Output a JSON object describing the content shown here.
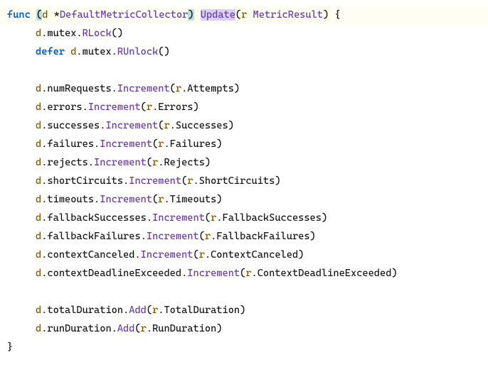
{
  "keywords": {
    "func": "func",
    "defer": "defer"
  },
  "sig": {
    "receiver_var": "d",
    "star": "*",
    "receiver_type": "DefaultMetricCollector",
    "func_name": "Update",
    "param_var": "r",
    "param_type": "MetricResult"
  },
  "lock": {
    "var": "d",
    "mutex": "mutex",
    "rlock": "RLock",
    "runlock": "RUnlock"
  },
  "lines": [
    {
      "obj": "d",
      "field": "numRequests",
      "method": "Increment",
      "arg_obj": "r",
      "arg_field": "Attempts"
    },
    {
      "obj": "d",
      "field": "errors",
      "method": "Increment",
      "arg_obj": "r",
      "arg_field": "Errors"
    },
    {
      "obj": "d",
      "field": "successes",
      "method": "Increment",
      "arg_obj": "r",
      "arg_field": "Successes"
    },
    {
      "obj": "d",
      "field": "failures",
      "method": "Increment",
      "arg_obj": "r",
      "arg_field": "Failures"
    },
    {
      "obj": "d",
      "field": "rejects",
      "method": "Increment",
      "arg_obj": "r",
      "arg_field": "Rejects"
    },
    {
      "obj": "d",
      "field": "shortCircuits",
      "method": "Increment",
      "arg_obj": "r",
      "arg_field": "ShortCircuits"
    },
    {
      "obj": "d",
      "field": "timeouts",
      "method": "Increment",
      "arg_obj": "r",
      "arg_field": "Timeouts"
    },
    {
      "obj": "d",
      "field": "fallbackSuccesses",
      "method": "Increment",
      "arg_obj": "r",
      "arg_field": "FallbackSuccesses"
    },
    {
      "obj": "d",
      "field": "fallbackFailures",
      "method": "Increment",
      "arg_obj": "r",
      "arg_field": "FallbackFailures"
    },
    {
      "obj": "d",
      "field": "contextCanceled",
      "method": "Increment",
      "arg_obj": "r",
      "arg_field": "ContextCanceled"
    },
    {
      "obj": "d",
      "field": "contextDeadlineExceeded",
      "method": "Increment",
      "arg_obj": "r",
      "arg_field": "ContextDeadlineExceeded"
    }
  ],
  "durations": [
    {
      "obj": "d",
      "field": "totalDuration",
      "method": "Add",
      "arg_obj": "r",
      "arg_field": "TotalDuration"
    },
    {
      "obj": "d",
      "field": "runDuration",
      "method": "Add",
      "arg_obj": "r",
      "arg_field": "RunDuration"
    }
  ],
  "braces": {
    "open": "{",
    "close": "}",
    "lparen": "(",
    "rparen": ")"
  },
  "space": " ",
  "dot": "."
}
